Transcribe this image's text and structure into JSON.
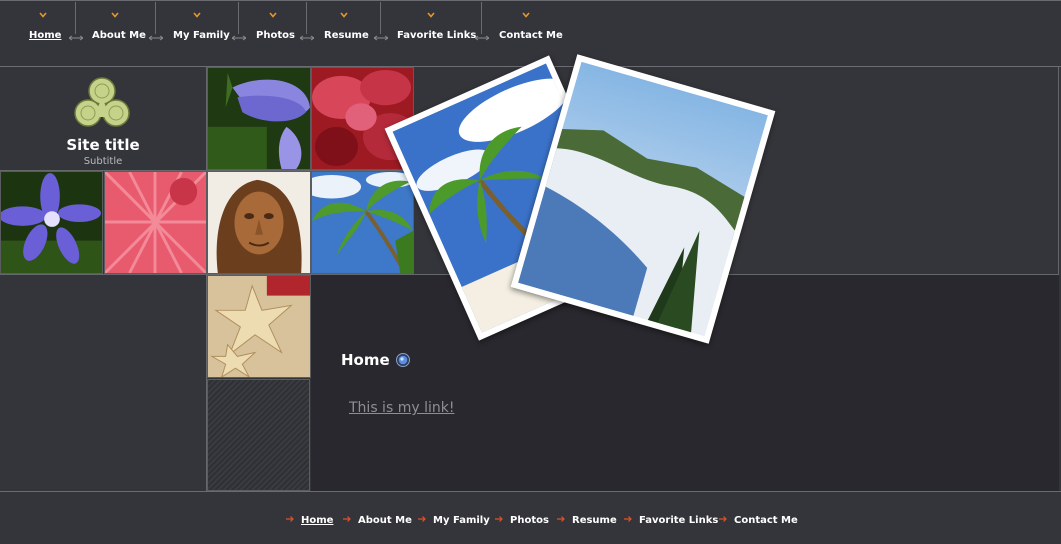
{
  "nav": {
    "items": [
      {
        "label": "Home",
        "current": true
      },
      {
        "label": "About Me"
      },
      {
        "label": "My Family"
      },
      {
        "label": "Photos"
      },
      {
        "label": "Resume"
      },
      {
        "label": "Favorite Links"
      },
      {
        "label": "Contact Me"
      }
    ]
  },
  "site": {
    "title": "Site title",
    "subtitle": "Subtitle"
  },
  "content": {
    "heading": "Home",
    "link_text": "This is my link!"
  },
  "footer": {
    "items": [
      {
        "label": "Home",
        "current": true
      },
      {
        "label": "About Me"
      },
      {
        "label": "My Family"
      },
      {
        "label": "Photos"
      },
      {
        "label": "Resume"
      },
      {
        "label": "Favorite Links"
      },
      {
        "label": "Contact Me"
      }
    ]
  },
  "colors": {
    "background": "#34353a",
    "content_panel": "#28282e",
    "nav_accent": "#e8962a",
    "footer_arrow": "#e0522a",
    "logo": "#c4d28a",
    "link": "#8e8f94"
  },
  "icons": {
    "nav_marker": "chevron-down-icon",
    "nav_separator": "double-arrow-icon",
    "footer_marker": "arrow-right-icon",
    "heading_bullet": "bullet-icon",
    "logo": "trefoil-logo"
  }
}
